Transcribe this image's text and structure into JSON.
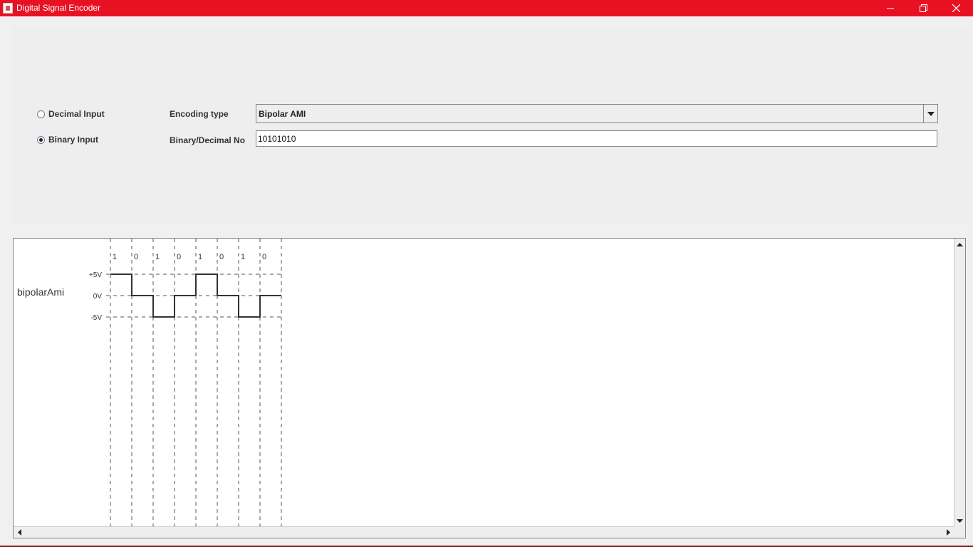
{
  "window": {
    "title": "Digital Signal Encoder",
    "title_bar_color": "#e81123"
  },
  "input_mode": {
    "options": [
      {
        "label": "Decimal Input",
        "checked": false
      },
      {
        "label": "Binary Input",
        "checked": true
      }
    ]
  },
  "encoding": {
    "label": "Encoding type",
    "selected": "Bipolar AMI"
  },
  "number": {
    "label": "Binary/Decimal No",
    "value": "10101010"
  },
  "plot": {
    "signal_name": "bipolarAmi",
    "level_labels": [
      "+5V",
      "0V",
      "-5V"
    ],
    "bits": [
      "1",
      "0",
      "1",
      "0",
      "1",
      "0",
      "1",
      "0"
    ],
    "levels": [
      1,
      0,
      -1,
      0,
      1,
      0,
      -1,
      0
    ]
  },
  "icons": {
    "app": "java-app-icon",
    "minimize": "minimize-icon",
    "restore": "restore-icon",
    "close": "close-icon",
    "dropdown": "chevron-down-icon"
  }
}
